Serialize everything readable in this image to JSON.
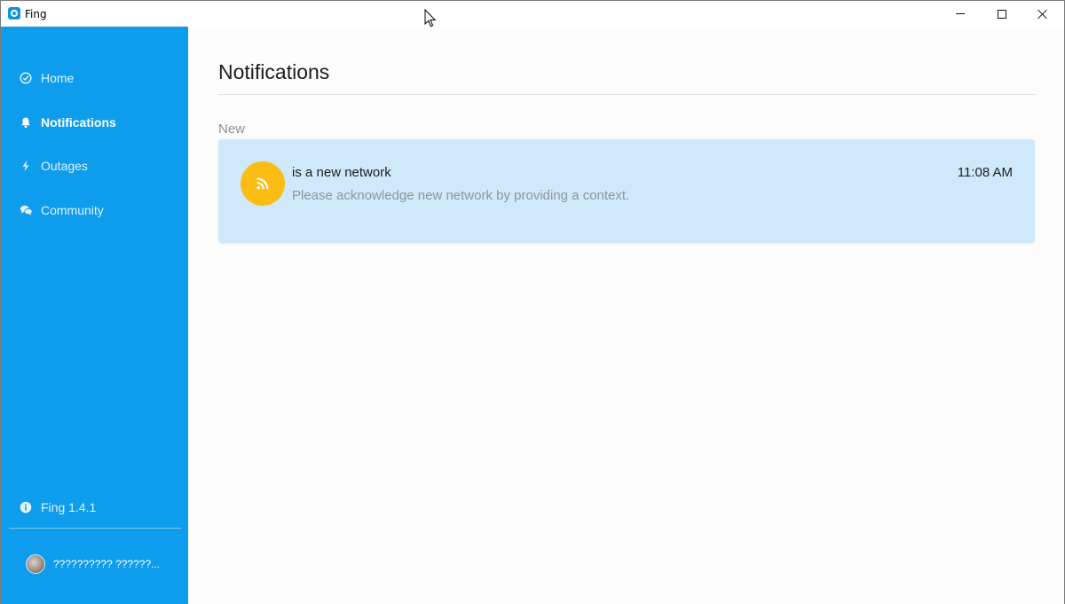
{
  "window": {
    "title": "Fing",
    "controls": {
      "minimize": "minimize",
      "maximize": "maximize",
      "close": "close"
    }
  },
  "sidebar": {
    "items": [
      {
        "label": "Home",
        "icon": "check-circle-icon"
      },
      {
        "label": "Notifications",
        "icon": "bell-icon",
        "active": true
      },
      {
        "label": "Outages",
        "icon": "lightning-icon"
      },
      {
        "label": "Community",
        "icon": "chat-bubbles-icon"
      }
    ],
    "version": {
      "label": "Fing 1.4.1",
      "icon": "info-icon"
    },
    "user": {
      "name": "?????????? ??????..."
    }
  },
  "main": {
    "title": "Notifications",
    "section_label": "New",
    "notifications": [
      {
        "title": "is a new network",
        "subtitle": "Please acknowledge new network by providing a context.",
        "time": "11:08 AM",
        "icon": "rss-icon",
        "icon_color": "#fbbd14"
      }
    ]
  },
  "colors": {
    "sidebar": "#0e9cec",
    "card": "#cfe9fa",
    "accent": "#fbbd14"
  }
}
